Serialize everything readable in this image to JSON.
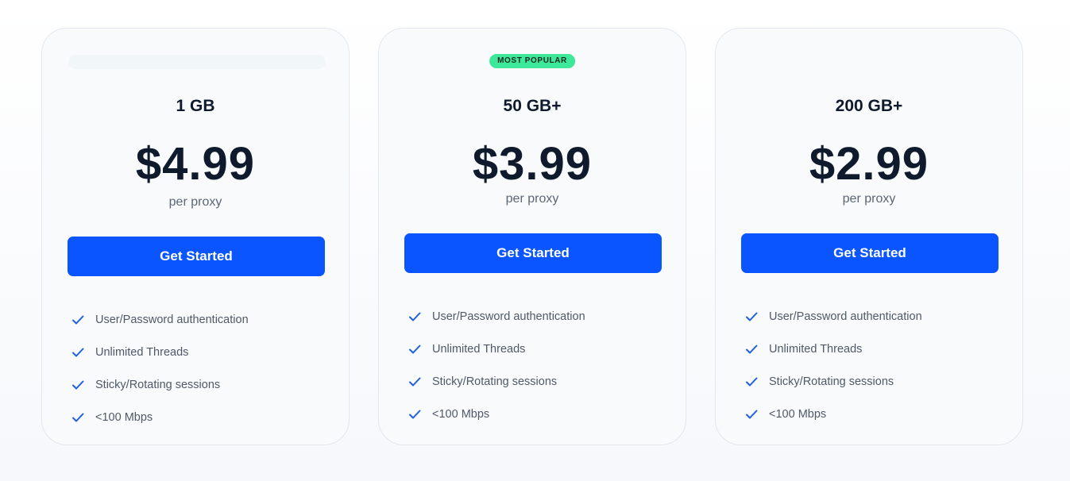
{
  "colors": {
    "accent": "#0a55ff",
    "badge": "#3ee89a",
    "check": "#1f5fe0",
    "text": "#0f1b2d",
    "muted": "#5c6675"
  },
  "plans": [
    {
      "name": "1 GB",
      "price": "$4.99",
      "unit": "per proxy",
      "cta": "Get Started",
      "features": [
        "User/Password authentication",
        "Unlimited Threads",
        "Sticky/Rotating sessions",
        "<100 Mbps"
      ]
    },
    {
      "badge": "MOST POPULAR",
      "name": "50 GB+",
      "price": "$3.99",
      "unit": "per proxy",
      "cta": "Get Started",
      "features": [
        "User/Password authentication",
        "Unlimited Threads",
        "Sticky/Rotating sessions",
        "<100 Mbps"
      ]
    },
    {
      "name": "200 GB+",
      "price": "$2.99",
      "unit": "per proxy",
      "cta": "Get Started",
      "features": [
        "User/Password authentication",
        "Unlimited Threads",
        "Sticky/Rotating sessions",
        "<100 Mbps"
      ]
    }
  ],
  "icons": {
    "check": "check-icon"
  }
}
